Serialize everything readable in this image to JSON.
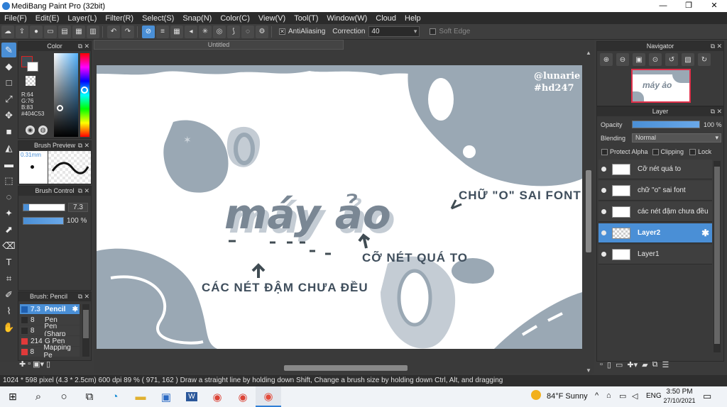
{
  "window": {
    "title": "MediBang Paint Pro (32bit)",
    "minimize": "—",
    "restore": "❐",
    "close": "✕"
  },
  "menu": [
    "File(F)",
    "Edit(E)",
    "Layer(L)",
    "Filter(R)",
    "Select(S)",
    "Snap(N)",
    "Color(C)",
    "View(V)",
    "Tool(T)",
    "Window(W)",
    "Cloud",
    "Help"
  ],
  "toolbar": {
    "antialiasing_label": "AntiAliasing",
    "correction_label": "Correction",
    "correction_value": "40",
    "soft_edge_label": "Soft Edge"
  },
  "color_panel": {
    "title": "Color",
    "r": "R:64",
    "g": "G:76",
    "b": "B:83",
    "hex": "#404C53",
    "main_color": "#404C53"
  },
  "brush_preview": {
    "title": "Brush Preview",
    "size": "0.31mm"
  },
  "brush_control": {
    "title": "Brush Control",
    "size_value": "7.3",
    "opacity_value": "100 %"
  },
  "brush_list": {
    "title": "Brush: Pencil",
    "items": [
      {
        "size": "7.3",
        "name": "Pencil",
        "color": "#1f5fb0",
        "selected": true
      },
      {
        "size": "8",
        "name": "Pen",
        "color": "#2b2b2b",
        "selected": false
      },
      {
        "size": "8",
        "name": "Pen (Sharp",
        "color": "#2b2b2b",
        "selected": false
      },
      {
        "size": "214",
        "name": "G Pen",
        "color": "#e03a3a",
        "selected": false
      },
      {
        "size": "8",
        "name": "Mapping Pe",
        "color": "#e03a3a",
        "selected": false
      }
    ]
  },
  "document": {
    "tab": "Untitled"
  },
  "canvas_text": {
    "watermark_line1": "@lunarie",
    "watermark_line2": "#hd247",
    "main_word": "máy ảo",
    "annot_font": "CHỮ \"O\" SAI FONT",
    "annot_size": "CỠ NÉT QUÁ TO",
    "annot_uneven": "CÁC NÉT ĐẬM CHƯA ĐỀU"
  },
  "navigator": {
    "title": "Navigator",
    "thumb_text": "máy ảo"
  },
  "layer_panel": {
    "title": "Layer",
    "opacity_label": "Opacity",
    "opacity_value": "100 %",
    "blending_label": "Blending",
    "blending_value": "Normal",
    "protect_alpha": "Protect Alpha",
    "clipping": "Clipping",
    "lock": "Lock",
    "layers": [
      {
        "name": "Cỡ nét quá to",
        "selected": false
      },
      {
        "name": "chữ \"o\" sai font",
        "selected": false
      },
      {
        "name": "các nét đậm chưa đều",
        "selected": false
      },
      {
        "name": "Layer2",
        "selected": true
      },
      {
        "name": "Layer1",
        "selected": false
      }
    ]
  },
  "status_bar": {
    "text": "1024 * 598 pixel  (4.3 * 2.5cm)  600 dpi  89 %  ( 971, 162 )  Draw a straight line by holding down Shift, Change a brush size by holding down Ctrl, Alt, and dragging"
  },
  "taskbar": {
    "weather": "84°F  Sunny",
    "lang": "ENG",
    "time": "3:50 PM",
    "date": "27/10/2021"
  },
  "colors": {
    "accent": "#4a8fd6",
    "blob": "#9aa8b4",
    "blob_light": "#c4ccd4",
    "ink": "#404C53"
  }
}
